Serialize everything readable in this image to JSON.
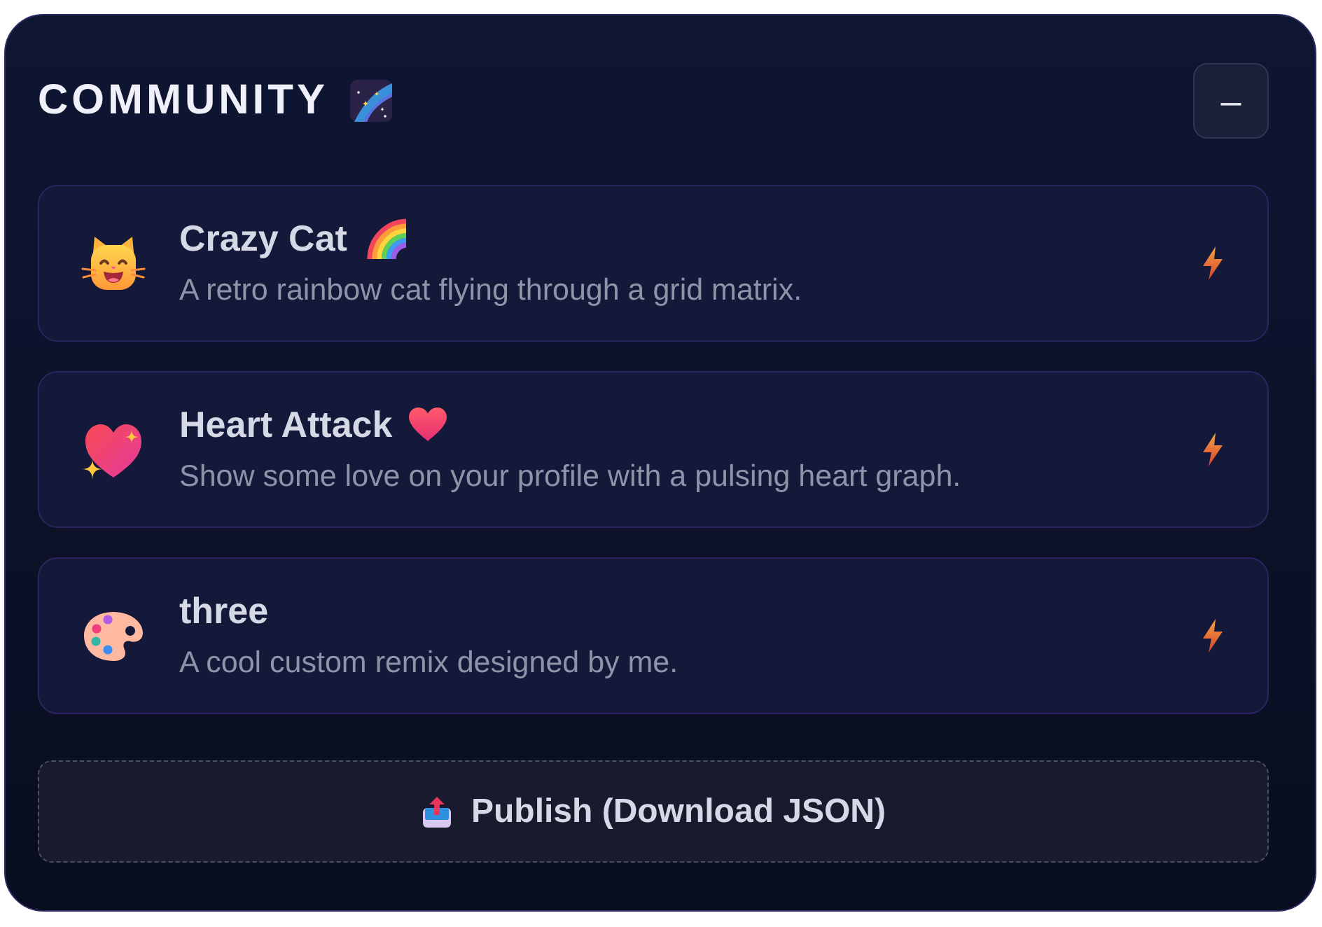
{
  "panel": {
    "title": "COMMUNITY",
    "collapse_button": {
      "label": "–"
    }
  },
  "remixes": [
    {
      "title": "Crazy Cat",
      "description": "A retro rainbow cat flying through a grid matrix."
    },
    {
      "title": "Heart Attack",
      "description": "Show some love on your profile with a pulsing heart graph."
    },
    {
      "title": "three",
      "description": "A cool custom remix designed by me."
    }
  ],
  "publish_button": {
    "label": "Publish (Download JSON)"
  }
}
